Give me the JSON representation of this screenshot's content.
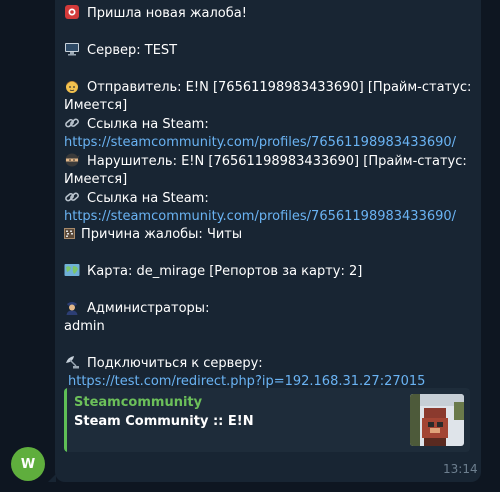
{
  "sender": {
    "avatar_initial": "W",
    "avatar_color": "#5fae3d"
  },
  "message": {
    "header": "Пришла новая жалоба!",
    "server_line": "Сервер: TEST",
    "sender_line_1": "Отправитель: E!N [76561198983433690] [Прайм-статус:",
    "sender_line_2": "Имеется]",
    "steam_link_label_1": "Ссылка на Steam:",
    "steam_link_1": "https://steamcommunity.com/profiles/76561198983433690/",
    "violator_line_1": "Нарушитель: E!N [76561198983433690] [Прайм-статус:",
    "violator_line_2": "Имеется]",
    "steam_link_label_2": "Ссылка на Steam:",
    "steam_link_2": "https://steamcommunity.com/profiles/76561198983433690/",
    "reason_line": "Причина жалобы: Читы",
    "map_line": "Карта: de_mirage [Репортов за карту: 2]",
    "admins_label": "Администраторы:",
    "admins_value": "admin",
    "connect_label": "Подключиться к серверу:",
    "connect_link": "https://test.com/redirect.php?ip=192.168.31.27:27015",
    "time": "13:14"
  },
  "link_preview": {
    "site_name": "Steamcommunity",
    "title": "Steam Community :: E!N",
    "accent_color": "#5fbf56"
  },
  "colors": {
    "background": "#0e1621",
    "bubble": "#182533",
    "link": "#6ab3f3",
    "timestamp": "#6d7f8f"
  },
  "icons": {
    "header": "rotating-light-icon",
    "server": "desktop-computer-icon",
    "sender": "person-face-icon",
    "link": "chain-link-icon",
    "violator": "ninja-icon",
    "reason": "abacus-icon",
    "map": "world-map-icon",
    "admins": "police-officer-icon",
    "connect": "satellite-antenna-icon"
  }
}
